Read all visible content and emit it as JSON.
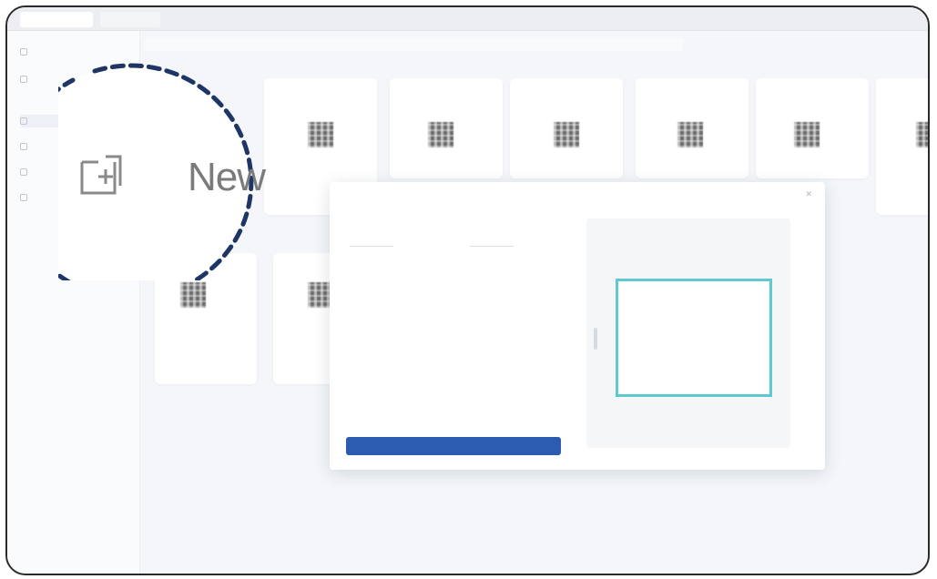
{
  "window": {
    "title": "",
    "tabs": [
      {
        "label": "",
        "active": true
      },
      {
        "label": "",
        "active": false
      }
    ]
  },
  "sidebar": {
    "items": [
      {
        "label": "",
        "icon": "new-icon"
      },
      {
        "label": "",
        "icon": "folder-icon"
      },
      {
        "label": "",
        "icon": "grid-icon",
        "active": true
      },
      {
        "label": "",
        "icon": "layers-icon"
      },
      {
        "label": "",
        "icon": "user-icon"
      },
      {
        "label": "",
        "icon": "settings-icon"
      }
    ]
  },
  "cards": [
    {
      "label": "",
      "sub": ""
    },
    {
      "label": "",
      "sub": ""
    },
    {
      "label": "",
      "sub": ""
    },
    {
      "label": "",
      "sub": ""
    },
    {
      "label": "",
      "sub": ""
    },
    {
      "label": "",
      "sub": ""
    },
    {
      "label": "",
      "sub": ""
    },
    {
      "label": "",
      "sub": ""
    }
  ],
  "dialog": {
    "title": "",
    "close_icon": "close-icon",
    "field_group": "",
    "field_a": "",
    "field_b": "",
    "section_1": "",
    "section_2": "",
    "button_label": "",
    "preview_caption": ""
  },
  "callout": {
    "label": "New",
    "icon": "new-document-icon"
  },
  "colors": {
    "accent": "#2c5cb2",
    "preview_outline": "#5ec9d2",
    "callout_border": "#1f3566"
  }
}
